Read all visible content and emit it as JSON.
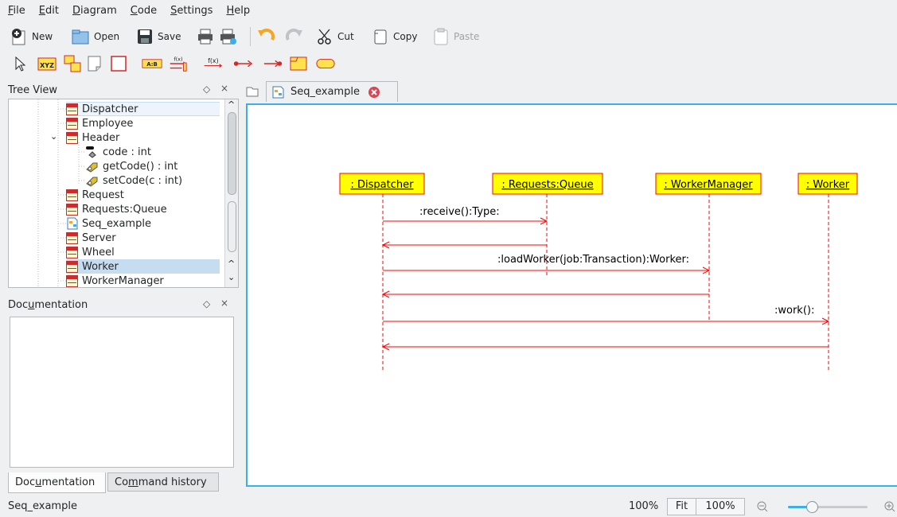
{
  "menu": {
    "items": [
      {
        "key": "F",
        "rest": "ile"
      },
      {
        "key": "E",
        "rest": "dit"
      },
      {
        "key": "D",
        "rest": "iagram"
      },
      {
        "key": "C",
        "rest": "ode"
      },
      {
        "key": "S",
        "rest": "ettings"
      },
      {
        "key": "H",
        "rest": "elp"
      }
    ]
  },
  "toolbar": {
    "new": "New",
    "open": "Open",
    "save": "Save",
    "cut": "Cut",
    "copy": "Copy",
    "paste": "Paste"
  },
  "tools": {
    "seq_message_sync_label": "f(x)",
    "seq_message_found_label": "f(x)",
    "class_label": "A:B",
    "object_label": "XYZ"
  },
  "tree": {
    "title": "Tree View",
    "items": [
      {
        "label": "Dispatcher",
        "icon": "class-icon"
      },
      {
        "label": "Employee",
        "icon": "class-icon"
      },
      {
        "label": "Header",
        "icon": "class-icon"
      },
      {
        "label": "code : int",
        "icon": "attribute-icon"
      },
      {
        "label": "getCode() : int",
        "icon": "operation-icon"
      },
      {
        "label": "setCode(c : int)",
        "icon": "operation-icon"
      },
      {
        "label": "Request",
        "icon": "class-icon"
      },
      {
        "label": "Requests:Queue",
        "icon": "class-icon"
      },
      {
        "label": "Seq_example",
        "icon": "sequence-diagram-icon"
      },
      {
        "label": "Server",
        "icon": "class-icon"
      },
      {
        "label": "Wheel",
        "icon": "class-icon"
      },
      {
        "label": "Worker",
        "icon": "class-icon"
      },
      {
        "label": "WorkerManager",
        "icon": "class-icon"
      }
    ]
  },
  "documentation": {
    "title_pre": "Doc",
    "title_key": "u",
    "title_post": "mentation",
    "tabs": [
      {
        "pre": "Doc",
        "key": "u",
        "post": "mentation"
      },
      {
        "pre": "Co",
        "key": "m",
        "post": "mand history"
      }
    ]
  },
  "diagram": {
    "tab_label": "Seq_example",
    "objects": [
      ": Dispatcher",
      ": Requests:Queue",
      ": WorkerManager",
      ": Worker"
    ],
    "messages": [
      ":receive():Type:",
      ":loadWorker(job:Transaction):Worker:",
      ":work():"
    ],
    "colors": {
      "object_fill": "#ffff00",
      "object_border": "#ff0000",
      "line": "#ff0000"
    }
  },
  "status": {
    "text": "Seq_example",
    "zoom": "100%",
    "fit": "Fit",
    "zoom_btn": "100%",
    "zoom_slider": 0.3
  }
}
